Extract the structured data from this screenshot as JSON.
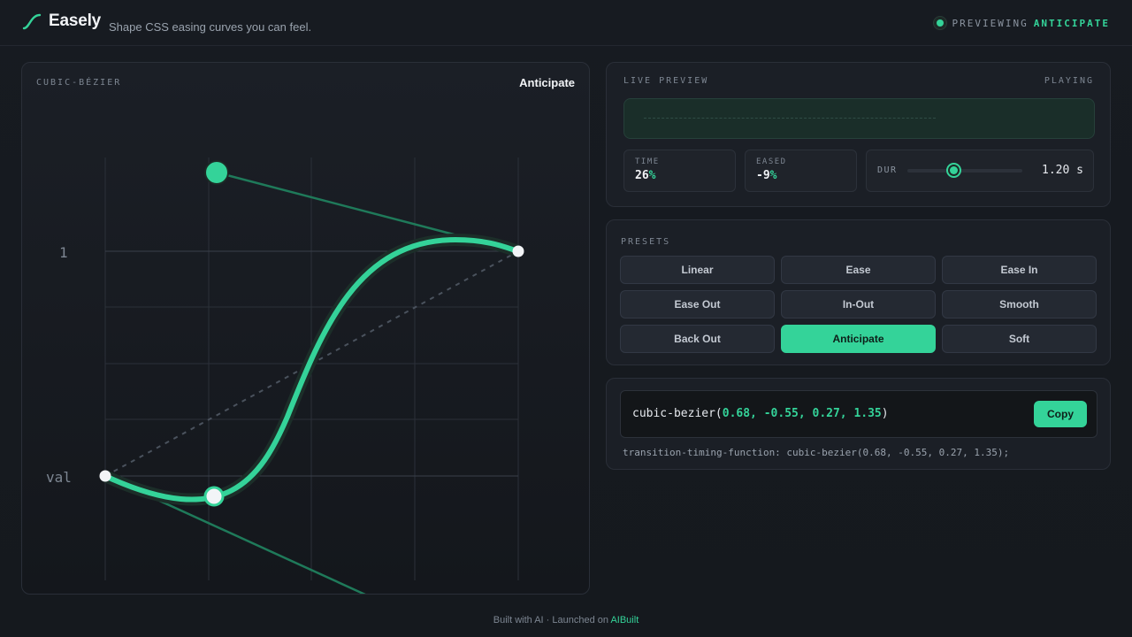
{
  "header": {
    "brand": "Easely",
    "tagline": "Shape CSS easing curves you can feel.",
    "previewing_label": "PREVIEWING",
    "previewing_name": "ANTICIPATE"
  },
  "editor": {
    "label": "CUBIC-BÉZIER",
    "preset_name": "Anticipate",
    "axis_label_top": "1",
    "axis_label_bottom": "val"
  },
  "live_preview": {
    "label": "LIVE PREVIEW",
    "status": "PLAYING",
    "time_label": "TIME",
    "time_value": "26",
    "eased_label": "EASED",
    "eased_value": "-9",
    "percent_sign": "%",
    "dur_label": "DUR",
    "dur_value": "1.20 s",
    "dur_slider_fraction": 0.4
  },
  "presets": {
    "label": "PRESETS",
    "items": [
      {
        "label": "Linear",
        "active": false
      },
      {
        "label": "Ease",
        "active": false
      },
      {
        "label": "Ease In",
        "active": false
      },
      {
        "label": "Ease Out",
        "active": false
      },
      {
        "label": "In-Out",
        "active": false
      },
      {
        "label": "Smooth",
        "active": false
      },
      {
        "label": "Back Out",
        "active": false
      },
      {
        "label": "Anticipate",
        "active": true
      },
      {
        "label": "Soft",
        "active": false
      }
    ]
  },
  "code": {
    "fn_open": "cubic-bezier(",
    "values": "0.68, -0.55, 0.27, 1.35",
    "fn_close": ")",
    "copy_label": "Copy",
    "css_line": "transition-timing-function: cubic-bezier(0.68, -0.55, 0.27, 1.35);"
  },
  "footer": {
    "text": "Built with AI · Launched on",
    "link": "AIBuilt"
  },
  "colors": {
    "accent": "#34d399",
    "background": "#161a1f",
    "panel": "#1b1f26"
  },
  "bezier": [
    0.68,
    -0.55,
    0.27,
    1.35
  ]
}
